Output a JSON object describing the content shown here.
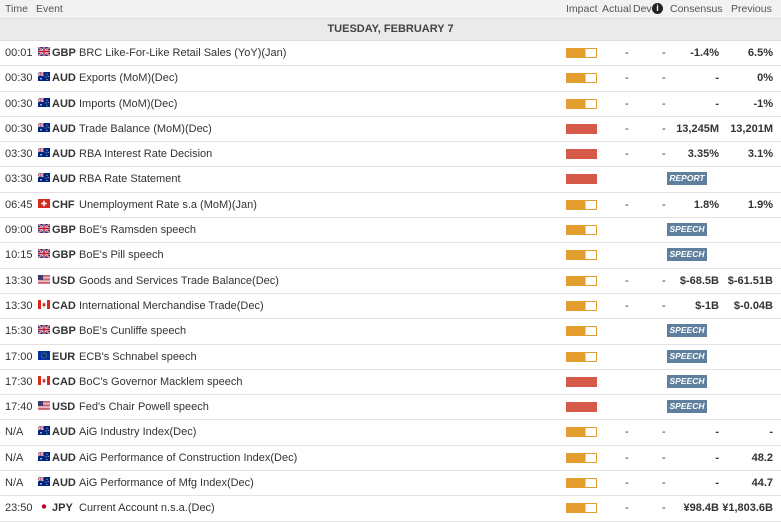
{
  "header": {
    "time": "Time",
    "event": "Event",
    "impact": "Impact",
    "actual": "Actual",
    "dev": "Dev",
    "info": "i",
    "consensus": "Consensus",
    "previous": "Previous"
  },
  "day": "TUESDAY, FEBRUARY 7",
  "colors": {
    "impact_medium": "#e39d2f",
    "impact_high": "#d65a4a",
    "badge": "#5e7f9e"
  },
  "rows": [
    {
      "time": "00:01",
      "currency": "GBP",
      "flag": "gb-flag-icon",
      "event": "BRC Like-For-Like Retail Sales (YoY)(Jan)",
      "impact": "medium",
      "actual": "-",
      "dev": "-",
      "consensus": "-1.4%",
      "previous": "6.5%",
      "badge": ""
    },
    {
      "time": "00:30",
      "currency": "AUD",
      "flag": "au-flag-icon",
      "event": "Exports (MoM)(Dec)",
      "impact": "medium",
      "actual": "-",
      "dev": "-",
      "consensus": "-",
      "previous": "0%",
      "badge": ""
    },
    {
      "time": "00:30",
      "currency": "AUD",
      "flag": "au-flag-icon",
      "event": "Imports (MoM)(Dec)",
      "impact": "medium",
      "actual": "-",
      "dev": "-",
      "consensus": "-",
      "previous": "-1%",
      "badge": ""
    },
    {
      "time": "00:30",
      "currency": "AUD",
      "flag": "au-flag-icon",
      "event": "Trade Balance (MoM)(Dec)",
      "impact": "high",
      "actual": "-",
      "dev": "-",
      "consensus": "13,245M",
      "previous": "13,201M",
      "badge": ""
    },
    {
      "time": "03:30",
      "currency": "AUD",
      "flag": "au-flag-icon",
      "event": "RBA Interest Rate Decision",
      "impact": "high",
      "actual": "-",
      "dev": "-",
      "consensus": "3.35%",
      "previous": "3.1%",
      "badge": ""
    },
    {
      "time": "03:30",
      "currency": "AUD",
      "flag": "au-flag-icon",
      "event": "RBA Rate Statement",
      "impact": "high",
      "actual": "",
      "dev": "",
      "consensus": "",
      "previous": "",
      "badge": "REPORT"
    },
    {
      "time": "06:45",
      "currency": "CHF",
      "flag": "ch-flag-icon",
      "event": "Unemployment Rate s.a (MoM)(Jan)",
      "impact": "medium",
      "actual": "-",
      "dev": "-",
      "consensus": "1.8%",
      "previous": "1.9%",
      "badge": ""
    },
    {
      "time": "09:00",
      "currency": "GBP",
      "flag": "gb-flag-icon",
      "event": "BoE's Ramsden speech",
      "impact": "medium",
      "actual": "",
      "dev": "",
      "consensus": "",
      "previous": "",
      "badge": "SPEECH"
    },
    {
      "time": "10:15",
      "currency": "GBP",
      "flag": "gb-flag-icon",
      "event": "BoE's Pill speech",
      "impact": "medium",
      "actual": "",
      "dev": "",
      "consensus": "",
      "previous": "",
      "badge": "SPEECH"
    },
    {
      "time": "13:30",
      "currency": "USD",
      "flag": "us-flag-icon",
      "event": "Goods and Services Trade Balance(Dec)",
      "impact": "medium",
      "actual": "-",
      "dev": "-",
      "consensus": "$-68.5B",
      "previous": "$-61.51B",
      "badge": ""
    },
    {
      "time": "13:30",
      "currency": "CAD",
      "flag": "ca-flag-icon",
      "event": "International Merchandise Trade(Dec)",
      "impact": "medium",
      "actual": "-",
      "dev": "-",
      "consensus": "$-1B",
      "previous": "$-0.04B",
      "badge": ""
    },
    {
      "time": "15:30",
      "currency": "GBP",
      "flag": "gb-flag-icon",
      "event": "BoE's Cunliffe speech",
      "impact": "medium",
      "actual": "",
      "dev": "",
      "consensus": "",
      "previous": "",
      "badge": "SPEECH"
    },
    {
      "time": "17:00",
      "currency": "EUR",
      "flag": "eu-flag-icon",
      "event": "ECB's Schnabel speech",
      "impact": "medium",
      "actual": "",
      "dev": "",
      "consensus": "",
      "previous": "",
      "badge": "SPEECH"
    },
    {
      "time": "17:30",
      "currency": "CAD",
      "flag": "ca-flag-icon",
      "event": "BoC's Governor Macklem speech",
      "impact": "high",
      "actual": "",
      "dev": "",
      "consensus": "",
      "previous": "",
      "badge": "SPEECH"
    },
    {
      "time": "17:40",
      "currency": "USD",
      "flag": "us-flag-icon",
      "event": "Fed's Chair Powell speech",
      "impact": "high",
      "actual": "",
      "dev": "",
      "consensus": "",
      "previous": "",
      "badge": "SPEECH"
    },
    {
      "time": "N/A",
      "currency": "AUD",
      "flag": "au-flag-icon",
      "event": "AiG Industry Index(Dec)",
      "impact": "medium",
      "actual": "-",
      "dev": "-",
      "consensus": "-",
      "previous": "-",
      "badge": ""
    },
    {
      "time": "N/A",
      "currency": "AUD",
      "flag": "au-flag-icon",
      "event": "AiG Performance of Construction Index(Dec)",
      "impact": "medium",
      "actual": "-",
      "dev": "-",
      "consensus": "-",
      "previous": "48.2",
      "badge": ""
    },
    {
      "time": "N/A",
      "currency": "AUD",
      "flag": "au-flag-icon",
      "event": "AiG Performance of Mfg Index(Dec)",
      "impact": "medium",
      "actual": "-",
      "dev": "-",
      "consensus": "-",
      "previous": "44.7",
      "badge": ""
    },
    {
      "time": "23:50",
      "currency": "JPY",
      "flag": "jp-flag-icon",
      "event": "Current Account n.s.a.(Dec)",
      "impact": "medium",
      "actual": "-",
      "dev": "-",
      "consensus": "¥98.4B",
      "previous": "¥1,803.6B",
      "badge": ""
    }
  ]
}
